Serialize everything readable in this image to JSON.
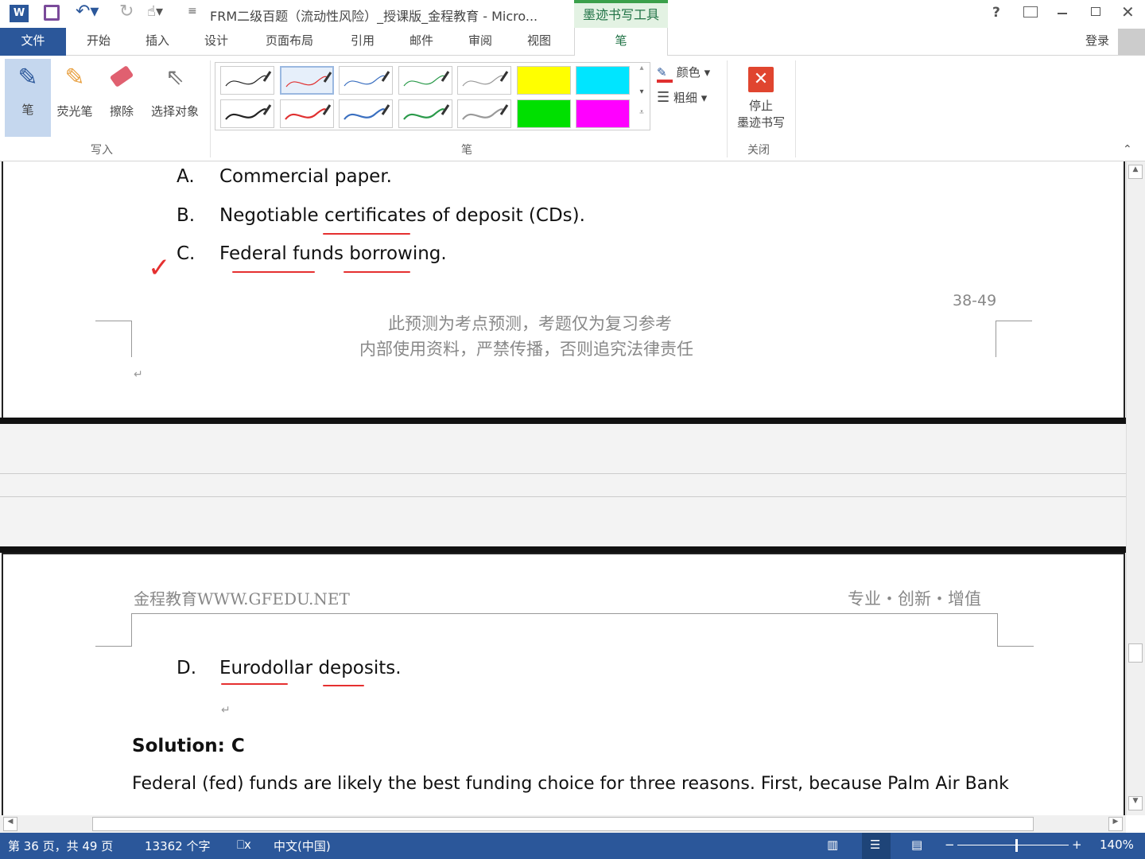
{
  "titlebar": {
    "title": "FRM二级百题（流动性风险）_授课版_金程教育 - Micro...",
    "context_tab": "墨迹书写工具",
    "help": "?",
    "sign_in": "登录"
  },
  "tabs": [
    {
      "label": "文件"
    },
    {
      "label": "开始"
    },
    {
      "label": "插入"
    },
    {
      "label": "设计"
    },
    {
      "label": "页面布局"
    },
    {
      "label": "引用"
    },
    {
      "label": "邮件"
    },
    {
      "label": "审阅"
    },
    {
      "label": "视图"
    },
    {
      "label": "笔"
    }
  ],
  "ribbon": {
    "write_group": {
      "label": "写入",
      "buttons": [
        {
          "label": "笔"
        },
        {
          "label": "荧光笔"
        },
        {
          "label": "擦除"
        },
        {
          "label": "选择对象"
        }
      ]
    },
    "pen_group": {
      "label": "笔",
      "color_label": "颜色",
      "thickness_label": "粗细",
      "swatches": [
        {
          "color": "#222222",
          "type": "pen"
        },
        {
          "color": "#e03030",
          "type": "pen"
        },
        {
          "color": "#3a6fc0",
          "type": "pen"
        },
        {
          "color": "#2a9a4a",
          "type": "pen"
        },
        {
          "color": "#999999",
          "type": "pen"
        },
        {
          "color": "#ffff00",
          "type": "highlighter"
        },
        {
          "color": "#00e5ff",
          "type": "highlighter"
        },
        {
          "color": "#222222",
          "type": "pen"
        },
        {
          "color": "#e03030",
          "type": "pen"
        },
        {
          "color": "#3a6fc0",
          "type": "pen"
        },
        {
          "color": "#2a9a4a",
          "type": "pen"
        },
        {
          "color": "#999999",
          "type": "pen"
        },
        {
          "color": "#00e000",
          "type": "highlighter"
        },
        {
          "color": "#ff00ff",
          "type": "highlighter"
        }
      ]
    },
    "close_group": {
      "label": "关闭",
      "stop_line1": "停止",
      "stop_line2": "墨迹书写"
    }
  },
  "page1": {
    "options": [
      {
        "letter": "A.",
        "text": "Commercial paper."
      },
      {
        "letter": "B.",
        "text": "Negotiable certificates of deposit (CDs)."
      },
      {
        "letter": "C.",
        "text": "Federal funds borrowing."
      }
    ],
    "page_ref": "38-49",
    "footer_line1": "此预测为考点预测，考题仅为复习参考",
    "footer_line2": "内部使用资料，严禁传播，否则追究法律责任"
  },
  "page2": {
    "header_left": "金程教育WWW.GFEDU.NET",
    "header_right": "专业・创新・增值",
    "option_d": {
      "letter": "D.",
      "text": "Eurodollar deposits."
    },
    "solution": "Solution: C",
    "body": "Federal (fed) funds are likely the best funding choice for three reasons. First, because Palm Air Bank"
  },
  "status": {
    "page": "第 36 页，共 49 页",
    "words": "13362 个字",
    "language": "中文(中国)",
    "zoom": "140%"
  },
  "colors": {
    "accent": "#2b579a",
    "ink_tab": "#217346",
    "ink_red": "#e53030"
  }
}
